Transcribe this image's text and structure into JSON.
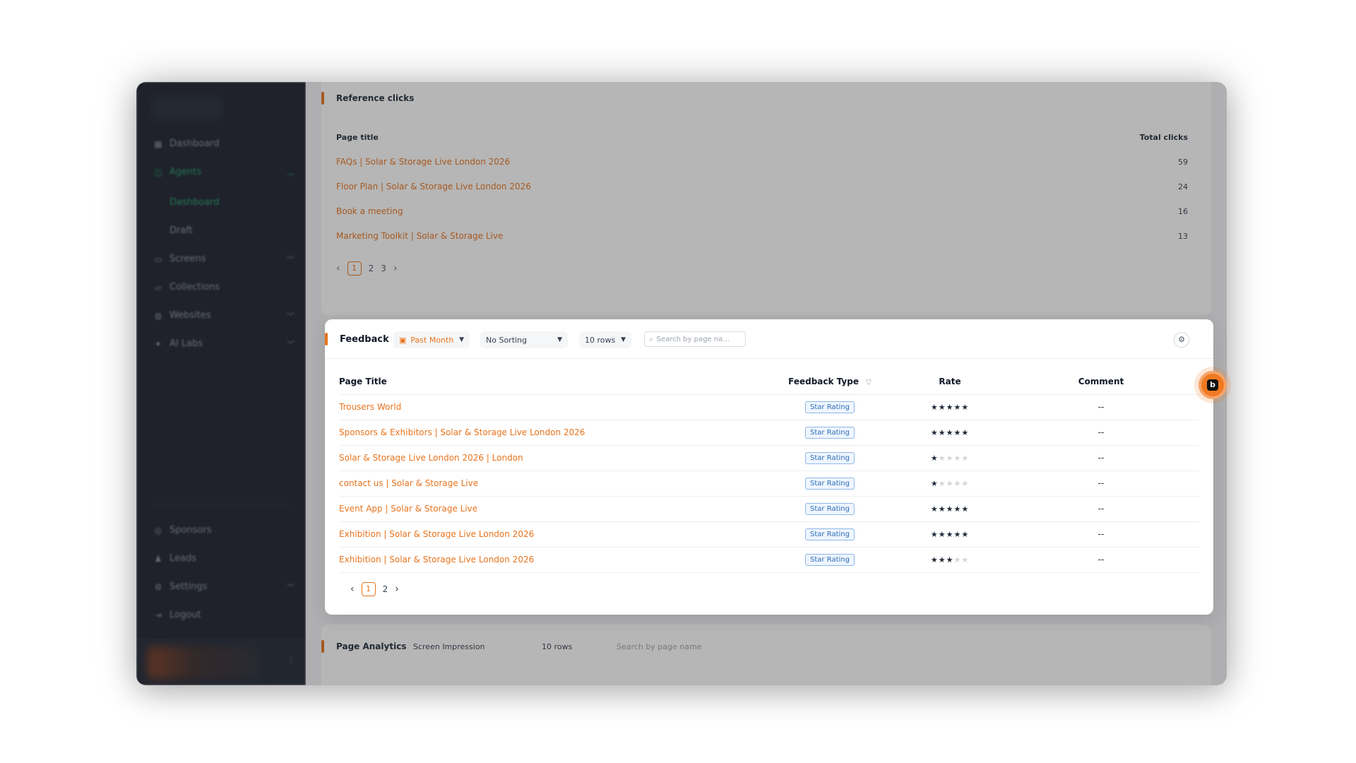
{
  "sidebar": {
    "items": [
      {
        "label": "Dashboard",
        "icon": "grid-icon"
      },
      {
        "label": "Agents",
        "icon": "agent-icon"
      },
      {
        "label": "Screens",
        "icon": "monitor-icon"
      },
      {
        "label": "Collections",
        "icon": "folder-icon"
      },
      {
        "label": "Websites",
        "icon": "globe-icon"
      },
      {
        "label": "AI Labs",
        "icon": "sparkle-icon"
      }
    ],
    "sub_items": [
      {
        "label": "Dashboard"
      },
      {
        "label": "Draft"
      }
    ],
    "bottom_items": [
      {
        "label": "Sponsors",
        "icon": "coin-icon"
      },
      {
        "label": "Leads",
        "icon": "users-icon"
      },
      {
        "label": "Settings",
        "icon": "gear-icon"
      },
      {
        "label": "Logout",
        "icon": "logout-icon"
      }
    ]
  },
  "reference_clicks": {
    "title": "Reference clicks",
    "col_title": "Page title",
    "col_clicks": "Total clicks",
    "rows": [
      {
        "title": "FAQs | Solar & Storage Live London 2026",
        "clicks": "59"
      },
      {
        "title": "Floor Plan | Solar & Storage Live London 2026",
        "clicks": "24"
      },
      {
        "title": "Book a meeting",
        "clicks": "16"
      },
      {
        "title": "Marketing Toolkit | Solar & Storage Live",
        "clicks": "13"
      }
    ],
    "pages": [
      "1",
      "2",
      "3"
    ]
  },
  "feedback": {
    "title": "Feedback",
    "period": "Past Month",
    "sorting": "No Sorting",
    "rows_per_page": "10 rows",
    "search_placeholder": "Search by page na...",
    "columns": {
      "page_title": "Page Title",
      "feedback_type": "Feedback Type",
      "rate": "Rate",
      "comment": "Comment"
    },
    "rows": [
      {
        "title": "Trousers World",
        "type": "Star Rating",
        "rating": 5,
        "comment": "--"
      },
      {
        "title": "Sponsors & Exhibitors | Solar & Storage Live London 2026",
        "type": "Star Rating",
        "rating": 5,
        "comment": "--"
      },
      {
        "title": "Solar & Storage Live London 2026 | London",
        "type": "Star Rating",
        "rating": 1,
        "comment": "--"
      },
      {
        "title": "contact us | Solar & Storage Live",
        "type": "Star Rating",
        "rating": 1,
        "comment": "--"
      },
      {
        "title": "Event App | Solar & Storage Live",
        "type": "Star Rating",
        "rating": 5,
        "comment": "--"
      },
      {
        "title": "Exhibition | Solar & Storage Live London 2026",
        "type": "Star Rating",
        "rating": 5,
        "comment": "--"
      },
      {
        "title": "Exhibition | Solar & Storage Live London 2026",
        "type": "Star Rating",
        "rating": 3,
        "comment": "--"
      }
    ],
    "pages": [
      "1",
      "2"
    ]
  },
  "page_analytics": {
    "title": "Page Analytics",
    "metric": "Screen Impression",
    "rows_per_page": "10 rows",
    "search_placeholder": "Search by page name"
  },
  "colors": {
    "accent": "#e8731c",
    "sidebar_bg": "#1a1f2c",
    "active_green": "#22a06b"
  }
}
